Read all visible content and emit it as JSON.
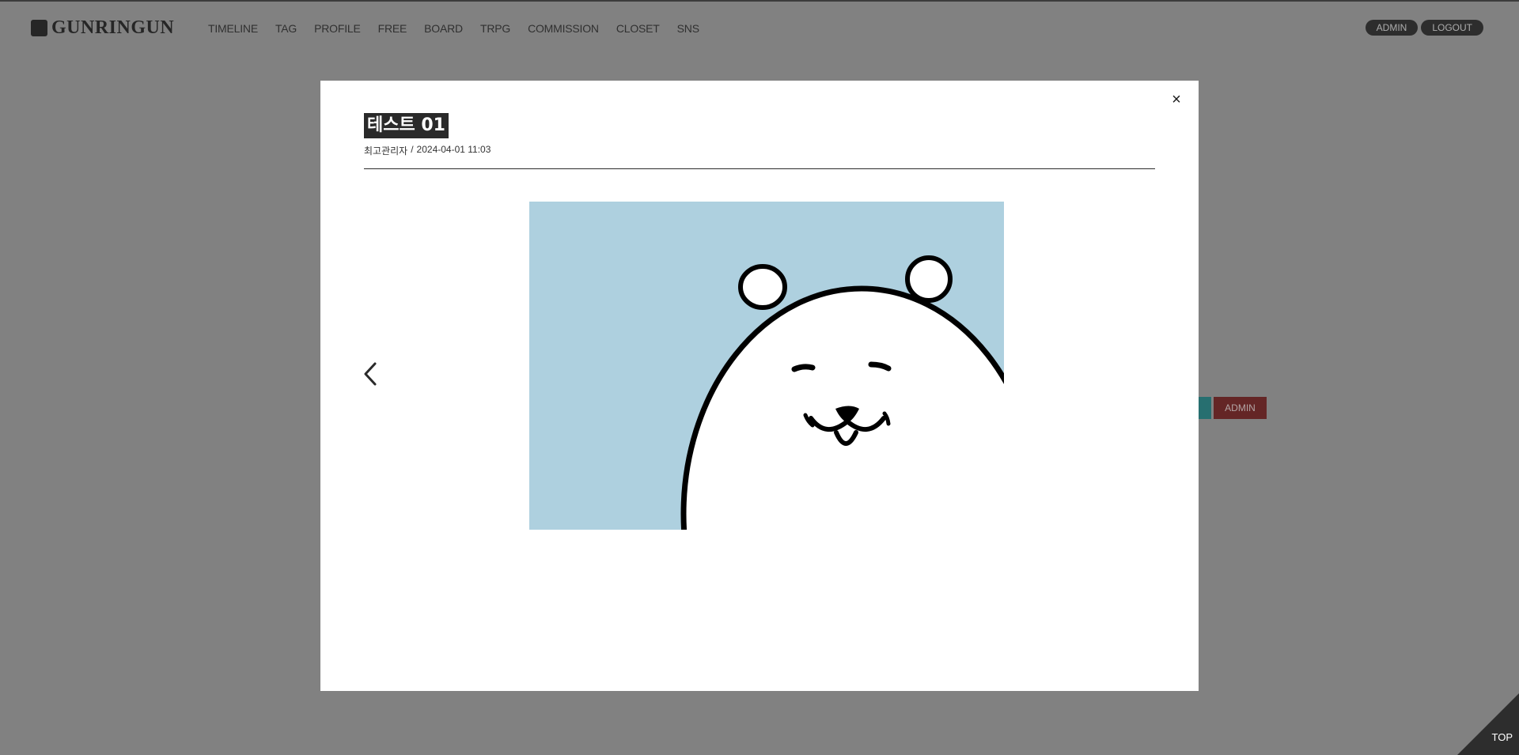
{
  "header": {
    "logo": "GUNRINGUN",
    "nav": [
      "TIMELINE",
      "TAG",
      "PROFILE",
      "FREE",
      "BOARD",
      "TRPG",
      "COMMISSION",
      "CLOSET",
      "SNS"
    ],
    "admin_label": "ADMIN",
    "logout_label": "LOGOUT"
  },
  "background": {
    "admin_badge": "ADMIN"
  },
  "modal": {
    "close_label": "×",
    "title": "테스트 01",
    "author": "최고관리자",
    "separator": "/",
    "datetime": "2024-04-01 11:03"
  },
  "top_button": "TOP",
  "colors": {
    "page_bg": "#a6a6a6",
    "image_bg": "#aed0df",
    "admin_badge": "#7a1b1b",
    "teal": "#1c8a8c"
  }
}
